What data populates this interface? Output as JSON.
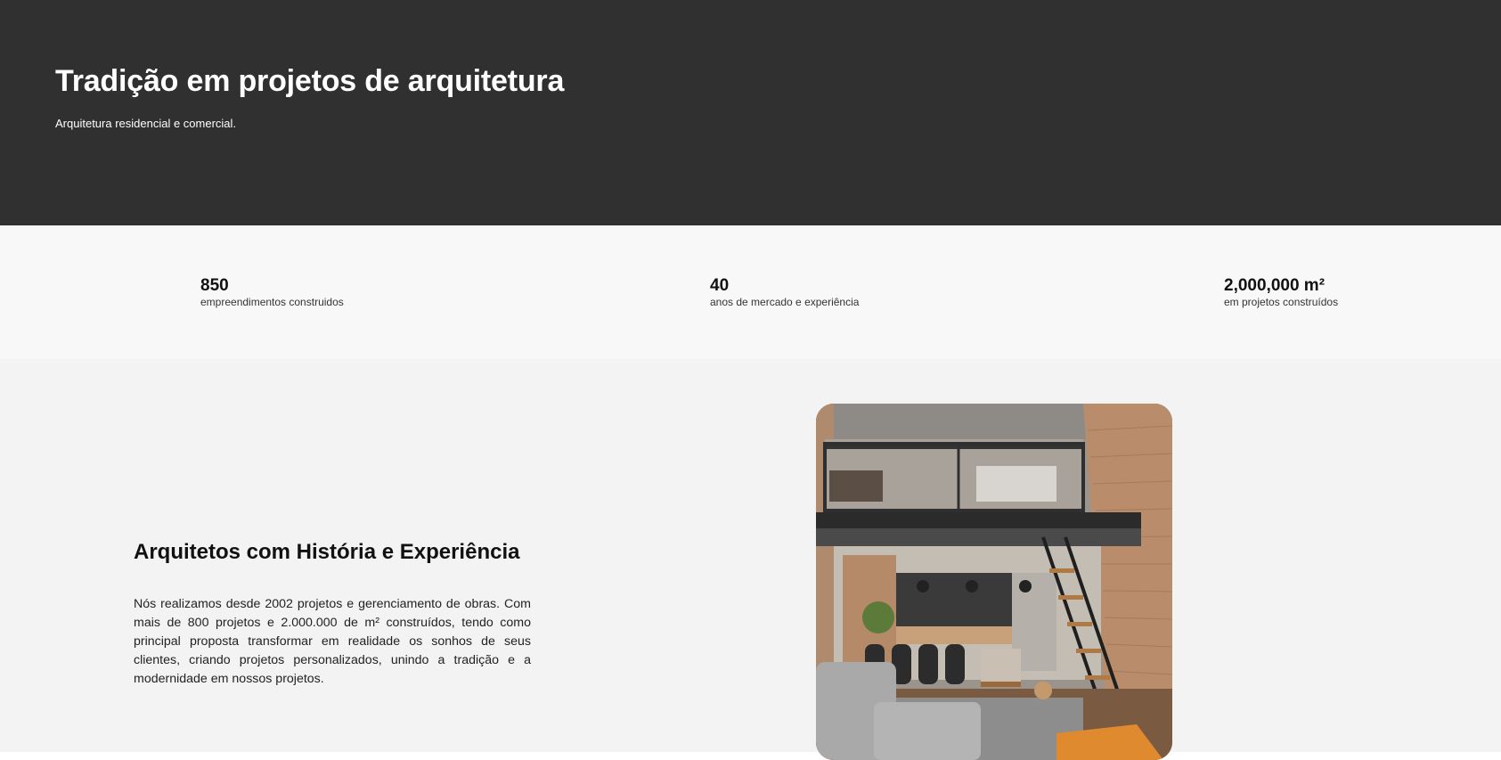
{
  "hero": {
    "title": "Tradição em projetos de arquitetura",
    "subtitle": "Arquitetura residencial e comercial."
  },
  "stats": [
    {
      "number": "850",
      "label": "empreendimentos construidos"
    },
    {
      "number": "40",
      "label": "anos de mercado e experiência"
    },
    {
      "number": "2,000,000 m²",
      "label": "em projetos construídos"
    }
  ],
  "about": {
    "title": "Arquitetos com História e Experiência",
    "text": "Nós realizamos desde 2002 projetos e gerenciamento de obras. Com mais de 800 projetos e 2.000.000 de m² construídos, tendo como principal proposta transformar em realidade os sonhos de seus clientes, criando projetos personalizados, unindo a tradição e a modernidade em nossos projetos."
  },
  "colors": {
    "hero_background": "#303030",
    "stats_background": "#f8f8f8",
    "about_background": "#f3f3f3",
    "heading_text": "#111111"
  },
  "images": {
    "about_photo": "loft-interior-photo"
  }
}
